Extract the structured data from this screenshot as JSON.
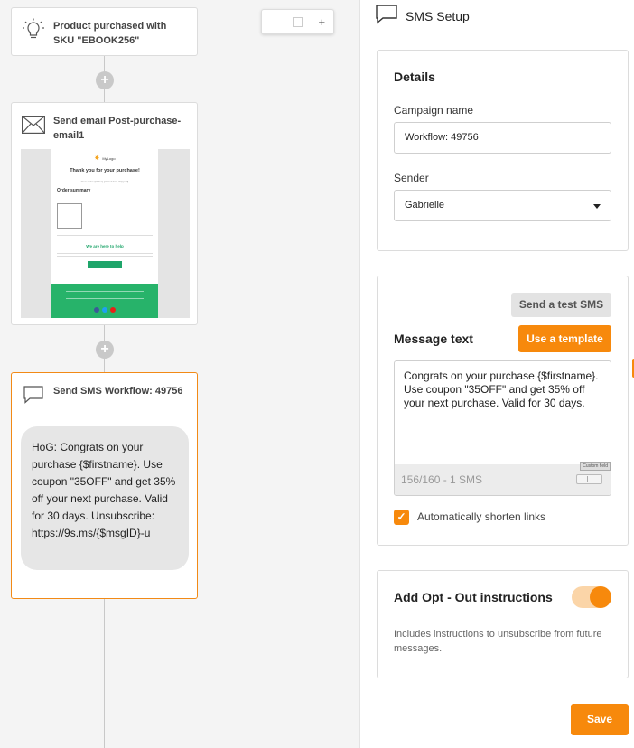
{
  "workflow": {
    "trigger_title": "Product purchased with SKU \"EBOOK256\"",
    "email_title": "Send email Post-purchase-email1",
    "sms_title": "Send SMS Workflow: 49756",
    "sms_preview": "HoG: Congrats on your purchase {$firstname}. Use coupon \"35OFF\" and get 35% off your next purchase. Valid for 30 days. Unsubscribe: https://9s.ms/{$msgID}-u",
    "add_step_symbol": "+"
  },
  "zoom": {
    "minus": "–",
    "plus": "+"
  },
  "email_preview": {
    "logo": "MyLogo",
    "heading": "Thank you for your purchase!",
    "subtext": "Your order (Order) {Jerrod has shipped}",
    "order_summary": "Order summary",
    "help_heading": "We are here to help"
  },
  "panel": {
    "title": "SMS Setup",
    "details": {
      "title": "Details",
      "campaign_label": "Campaign name",
      "campaign_value": "Workflow: 49756",
      "sender_label": "Sender",
      "sender_value": "Gabrielle"
    },
    "message": {
      "test_button": "Send a test SMS",
      "title": "Message text",
      "template_button": "Use a template",
      "text": "Congrats on your purchase {$firstname}. Use coupon \"35OFF\" and get 35% off your next purchase. Valid for 30 days.",
      "counter": "156/160 - 1 SMS",
      "custom_field_tip": "Custom field",
      "shorten_label": "Automatically shorten links",
      "shorten_checked": true
    },
    "optout": {
      "title": "Add Opt - Out instructions",
      "enabled": true,
      "note": "Includes instructions to unsubscribe from future messages."
    },
    "save_button": "Save"
  },
  "colors": {
    "accent": "#f7890c",
    "green": "#1ea56a"
  }
}
